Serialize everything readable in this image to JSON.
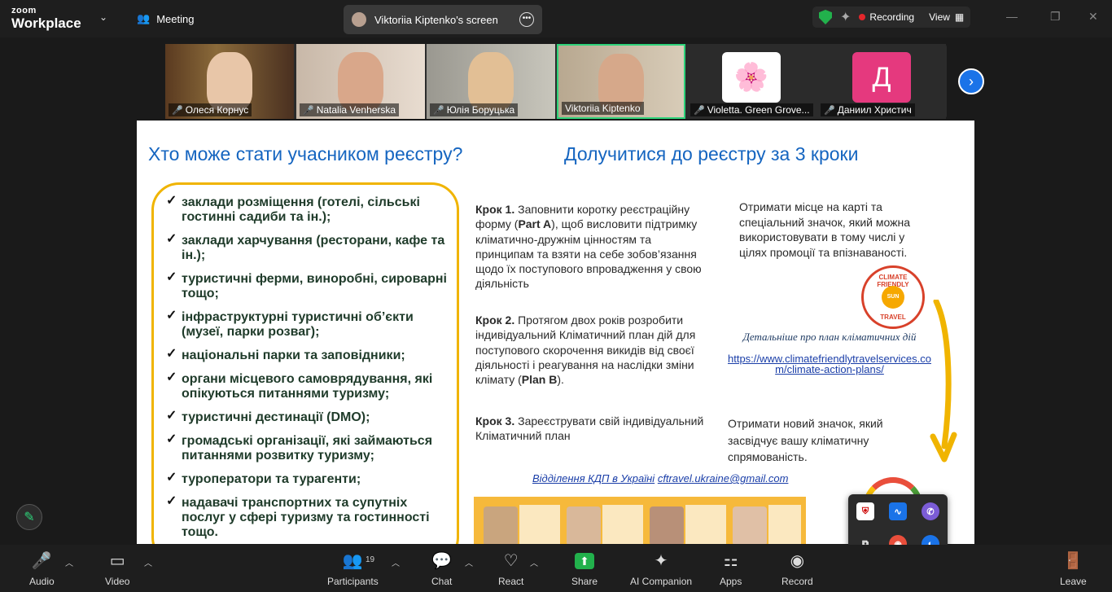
{
  "app": {
    "logo_top": "zoom",
    "logo_bottom": "Workplace",
    "meeting_tab": "Meeting",
    "screen_tab": "Viktoriia Kiptenko's screen",
    "recording": "Recording",
    "view": "View"
  },
  "participants": [
    {
      "name": "Олеся Корнус"
    },
    {
      "name": "Natalia Venherska"
    },
    {
      "name": "Юлія Боруцька"
    },
    {
      "name": "Viktoriia Kiptenko"
    },
    {
      "name": "Violetta. Green Grove..."
    },
    {
      "name": "Даниил Христич",
      "initial": "Д"
    }
  ],
  "slide": {
    "heading_left": "Хто може стати учасником реєстру?",
    "heading_right": "Долучитися до реєстру за 3 кроки",
    "bullets": [
      "заклади розміщення (готелі, сільські гостинні садиби та ін.);",
      "заклади харчування (ресторани, кафе та ін.);",
      "туристичні ферми, виноробні, сироварні тощо;",
      "інфраструктурні туристичні об’єкти (музеї, парки розваг);",
      "національні парки та заповідники;",
      "органи місцевого самоврядування, які опікуються питаннями туризму;",
      "туристичні дестинації (DMO);",
      "громадські організації, які займаються питаннями розвитку туризму;",
      "туроператори та турагенти;",
      "надавачі транспортних та супутніх послуг у сфері туризму та гостинності тощо."
    ],
    "step1_label": "Крок 1.",
    "step1_text_a": " Заповнити коротку реєстраційну форму (",
    "step1_part": "Part A",
    "step1_text_b": "), щоб висловити підтримку кліматично-дружнім цінностям та принципам та взяти на себе зобов’язання щодо їх поступового впровадження у свою діяльність",
    "step2_label": "Крок 2.",
    "step2_text_a": " Протягом двох років розробити індивідуальний Кліматичний план дій для поступового скорочення викидів від своєї діяльності і реагування на наслідки зміни клімату (",
    "step2_part": "Plan B",
    "step2_text_b": ").",
    "step3_label": "Крок 3.",
    "step3_text": " Зареєструвати свій індивідуальний Кліматичний план",
    "right1": "Отримати місце на карті та спеціальний значок, який можна використовувати в тому числі у цілях промоції та впізнаваності.",
    "more_info": "Детальніше про план кліматичних дій",
    "link": "https://www.climatefriendlytravelservices.com/climate-action-plans/",
    "right2": "Отримати новий значок, який засвідчує вашу кліматичну спрямованість.",
    "kdp_label": "Відділення КДП в Україні",
    "kdp_email": "cftravel.ukraine@gmail.com",
    "badge_top": "CLIMATE FRIENDLY",
    "badge_mid": "SUN",
    "badge_bottom": "TRAVEL"
  },
  "toolbar": {
    "audio": "Audio",
    "video": "Video",
    "participants": "Participants",
    "participants_count": "19",
    "chat": "Chat",
    "react": "React",
    "share": "Share",
    "ai": "AI Companion",
    "apps": "Apps",
    "record": "Record",
    "leave": "Leave"
  },
  "colors": {
    "accent_green": "#22b14c",
    "record_red": "#e4262b",
    "slide_heading": "#1565c0",
    "box_yellow": "#f0b400"
  }
}
